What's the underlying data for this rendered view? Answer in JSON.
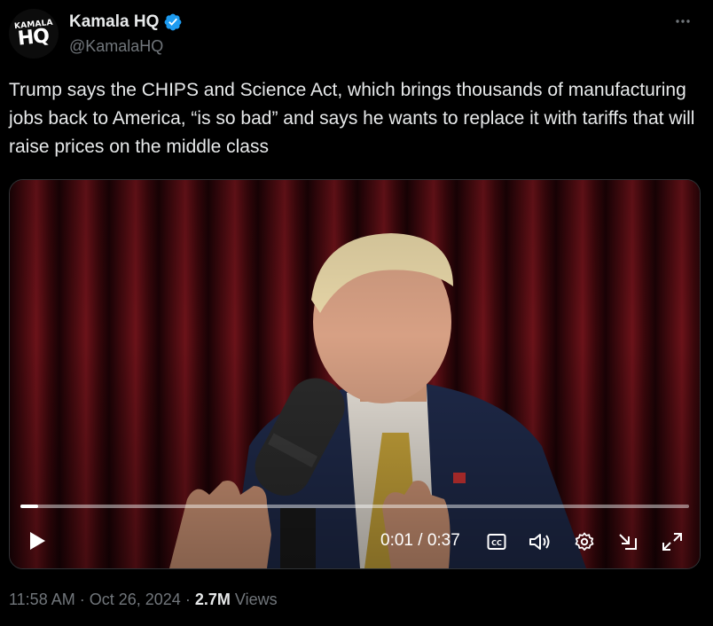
{
  "author": {
    "avatar_line1": "KAMALA",
    "avatar_line2": "HQ",
    "display_name": "Kamala HQ",
    "handle": "@KamalaHQ",
    "verified_color": "#1d9bf0"
  },
  "tweet": {
    "text": "Trump says the CHIPS and Science Act, which brings thousands of manufacturing jobs back to America, “is so bad” and says he wants to replace it with tariffs that will raise prices on the middle class"
  },
  "video": {
    "current_time": "0:01",
    "duration": "0:37",
    "time_display": "0:01 / 0:37",
    "progress": 0.027,
    "icons": [
      "play-icon",
      "captions-icon",
      "volume-icon",
      "settings-icon",
      "pip-icon",
      "fullscreen-icon"
    ]
  },
  "meta": {
    "time": "11:58 AM",
    "date": "Oct 26, 2024",
    "views_count": "2.7M",
    "views_label": "Views",
    "separator": "·"
  },
  "colors": {
    "background": "#000000",
    "text": "#e7e9ea",
    "secondary": "#71767b"
  }
}
